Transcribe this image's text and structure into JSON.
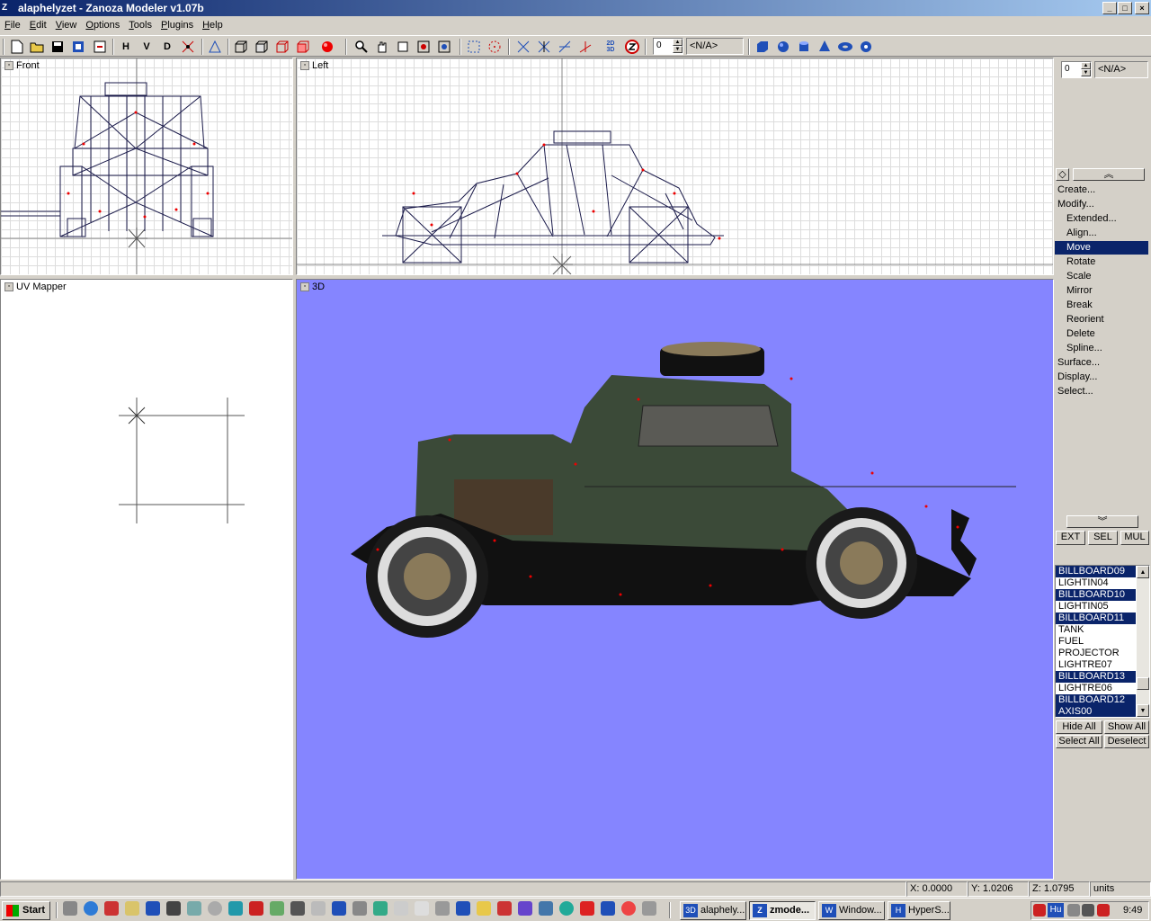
{
  "window": {
    "title": "alaphelyzet - Zanoza Modeler v1.07b",
    "icon": "zanoza-app-icon",
    "btn_min": "_",
    "btn_max": "□",
    "btn_close": "×"
  },
  "menu": [
    "File",
    "Edit",
    "View",
    "Options",
    "Tools",
    "Plugins",
    "Help"
  ],
  "toolbar": {
    "h_label": "H",
    "v_label": "V",
    "d_label": "D",
    "spin_value": "0",
    "combo_value": "<N/A>",
    "uv_label": "2D\n3D"
  },
  "viewports": {
    "front": "Front",
    "left": "Left",
    "uv": "UV Mapper",
    "view3d": "3D"
  },
  "rightpanel": {
    "spin_value": "0",
    "combo_value": "<N/A>",
    "menu": [
      {
        "label": "Create...",
        "sub": false,
        "selected": false
      },
      {
        "label": "Modify...",
        "sub": false,
        "selected": false
      },
      {
        "label": "Extended...",
        "sub": true,
        "selected": false
      },
      {
        "label": "Align...",
        "sub": true,
        "selected": false
      },
      {
        "label": "Move",
        "sub": true,
        "selected": true
      },
      {
        "label": "Rotate",
        "sub": true,
        "selected": false
      },
      {
        "label": "Scale",
        "sub": true,
        "selected": false
      },
      {
        "label": "Mirror",
        "sub": true,
        "selected": false
      },
      {
        "label": "Break",
        "sub": true,
        "selected": false
      },
      {
        "label": "Reorient",
        "sub": true,
        "selected": false
      },
      {
        "label": "Delete",
        "sub": true,
        "selected": false
      },
      {
        "label": "Spline...",
        "sub": true,
        "selected": false
      },
      {
        "label": "Surface...",
        "sub": false,
        "selected": false
      },
      {
        "label": "Display...",
        "sub": false,
        "selected": false
      },
      {
        "label": "Select...",
        "sub": false,
        "selected": false
      }
    ],
    "mode_buttons": [
      "EXT",
      "SEL",
      "MUL"
    ],
    "objects": [
      {
        "name": "BILLBOARD09",
        "selected": true
      },
      {
        "name": "LIGHTIN04",
        "selected": false
      },
      {
        "name": "BILLBOARD10",
        "selected": true
      },
      {
        "name": "LIGHTIN05",
        "selected": false
      },
      {
        "name": "BILLBOARD11",
        "selected": true
      },
      {
        "name": "TANK",
        "selected": false
      },
      {
        "name": "FUEL",
        "selected": false
      },
      {
        "name": "PROJECTOR",
        "selected": false
      },
      {
        "name": "LIGHTRE07",
        "selected": false
      },
      {
        "name": "BILLBOARD13",
        "selected": true
      },
      {
        "name": "LIGHTRE06",
        "selected": false
      },
      {
        "name": "BILLBOARD12",
        "selected": true
      },
      {
        "name": "AXIS00",
        "selected": true
      }
    ],
    "hide_all": "Hide All",
    "show_all": "Show All",
    "select_all": "Select All",
    "deselect": "Deselect"
  },
  "status": {
    "x": "X: 0.0000",
    "y": "Y: 1.0206",
    "z": "Z: 1.0795",
    "units": "units"
  },
  "taskbar": {
    "start": "Start",
    "tasks": [
      {
        "label": "alaphely...",
        "icon": "3D",
        "active": false
      },
      {
        "label": "zmode...",
        "icon": "Z",
        "active": true
      },
      {
        "label": "Window...",
        "icon": "W",
        "active": false
      },
      {
        "label": "HyperS...",
        "icon": "H",
        "active": false
      }
    ],
    "lang": "Hu",
    "clock": "9:49"
  },
  "colors": {
    "viewport3d": "#8585ff",
    "selection": "#0a246a",
    "car_body": "#3b4a38"
  }
}
